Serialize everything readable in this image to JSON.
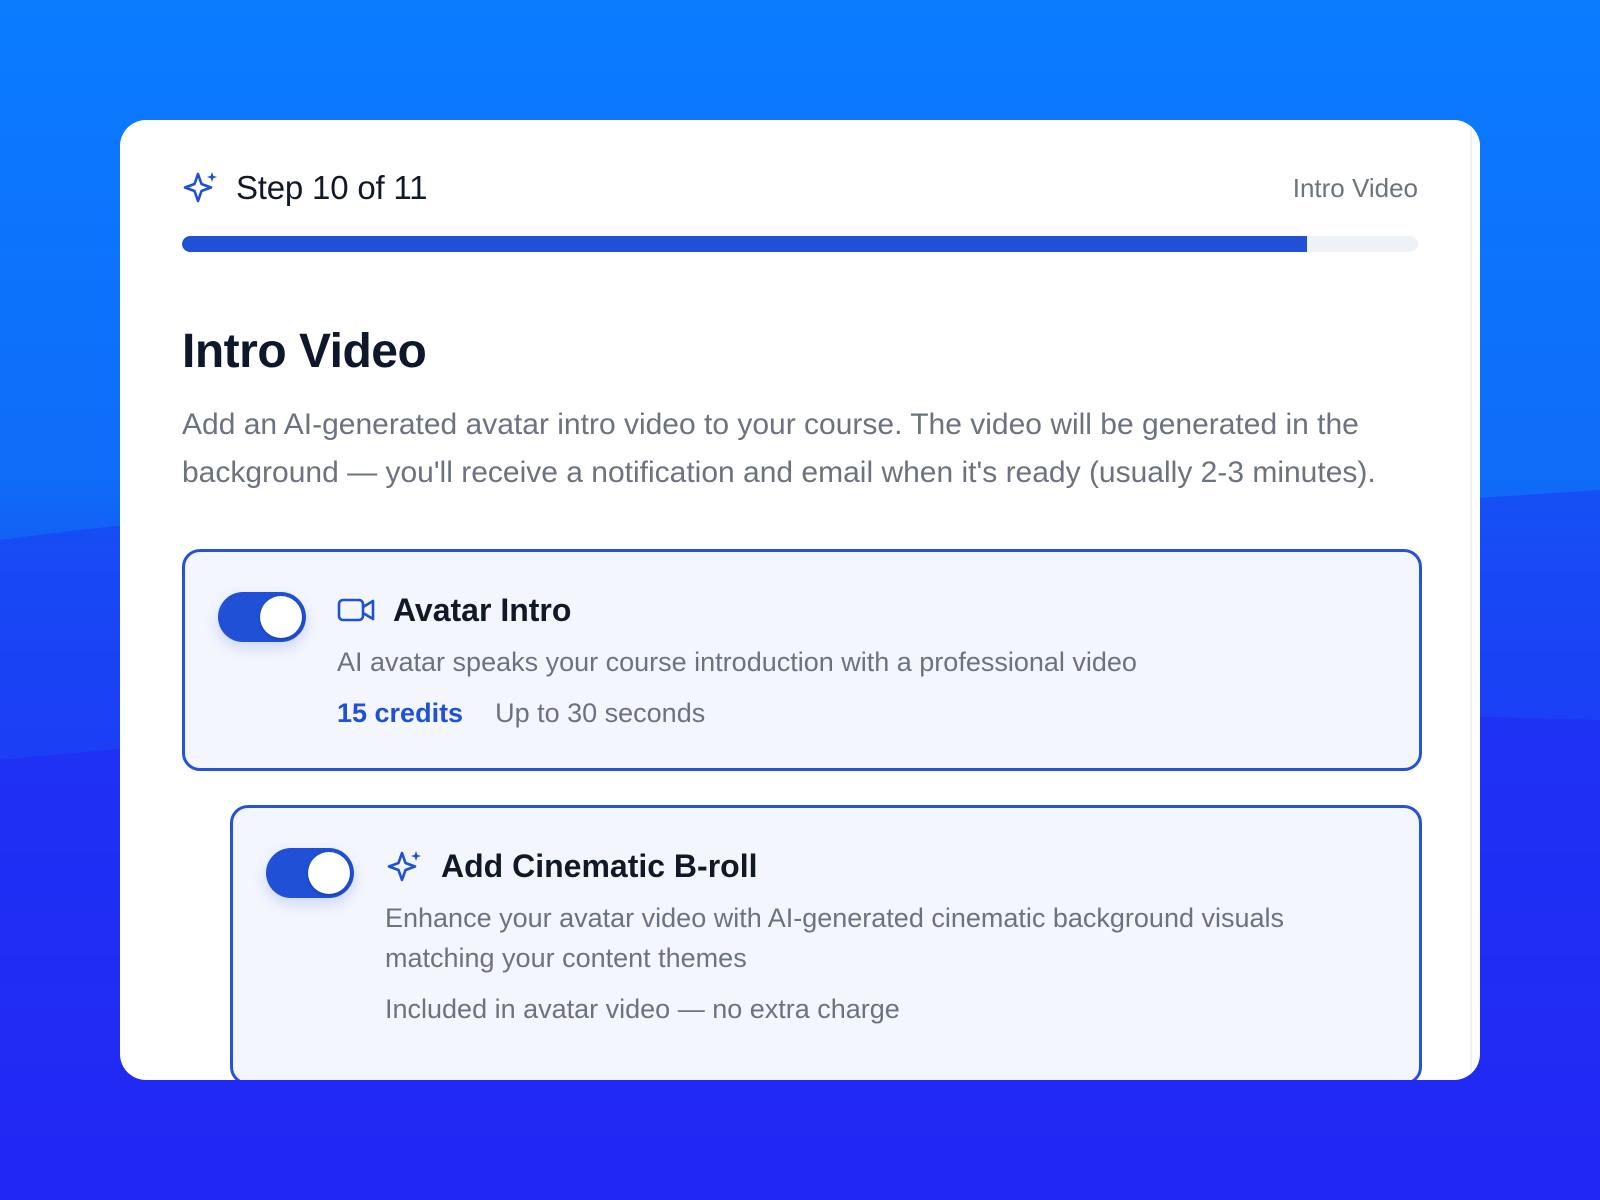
{
  "colors": {
    "accent": "#1f50d6",
    "card_background": "#ffffff",
    "option_background": "#f3f6fd",
    "muted_text": "#6b7280",
    "heading_text": "#111827"
  },
  "header": {
    "step_label": "Step 10 of 11",
    "step_icon": "sparkles-icon",
    "section_name": "Intro Video",
    "progress": 0.91
  },
  "main": {
    "title": "Intro Video",
    "description": "Add an AI-generated avatar intro video to your course. The video will be generated in the background — you'll receive a notification and email when it's ready (usually 2-3 minutes)."
  },
  "options": {
    "avatar_intro": {
      "enabled": true,
      "icon": "video-camera-icon",
      "title": "Avatar Intro",
      "description": "AI avatar speaks your course introduction with a professional video",
      "credits": "15 credits",
      "duration": "Up to 30 seconds"
    },
    "cinematic_broll": {
      "enabled": true,
      "icon": "sparkles-icon",
      "title": "Add Cinematic B-roll",
      "description": "Enhance your avatar video with AI-generated cinematic background visuals matching your content themes",
      "pricing_note": "Included in avatar video — no extra charge"
    }
  }
}
